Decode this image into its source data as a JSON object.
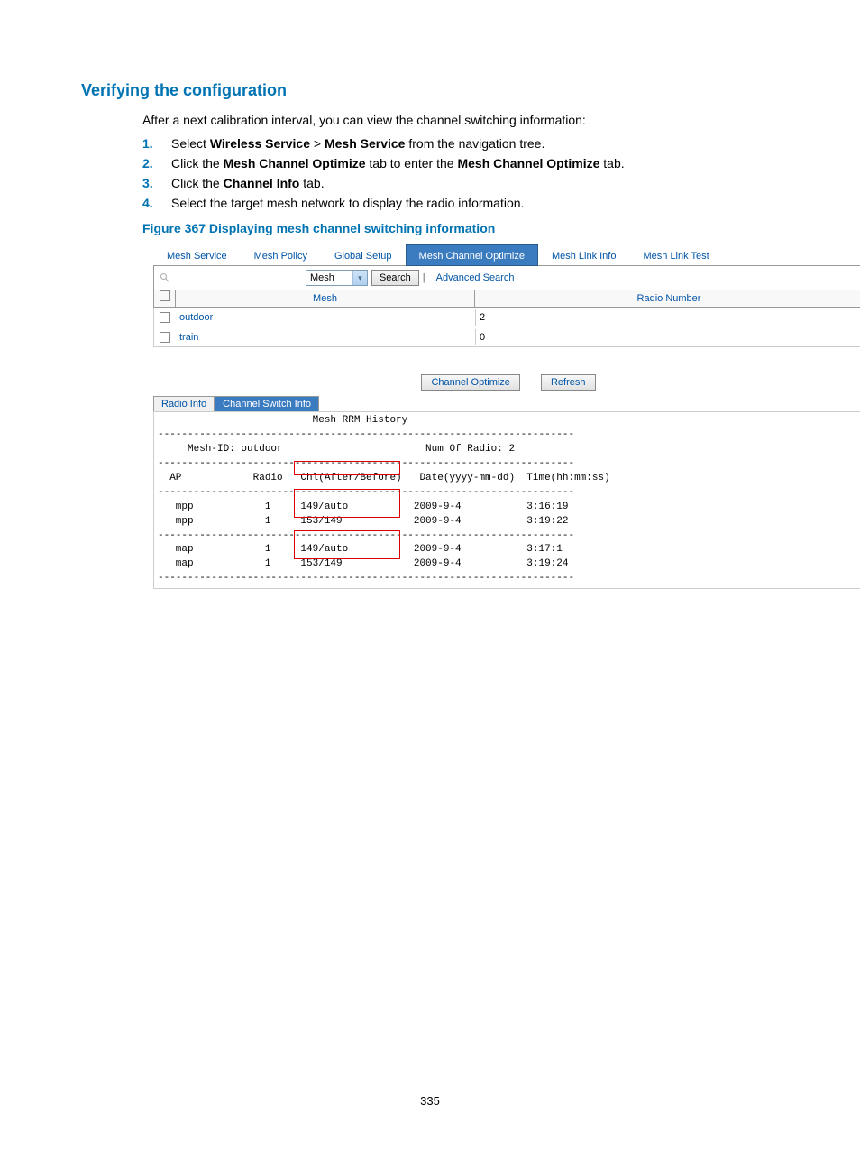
{
  "title": "Verifying the configuration",
  "intro": "After a next calibration interval, you can view the channel switching information:",
  "steps": [
    {
      "num": "1.",
      "pre": "Select ",
      "b1": "Wireless Service",
      "mid": " > ",
      "b2": "Mesh Service",
      "post": " from the navigation tree."
    },
    {
      "num": "2.",
      "pre": "Click the ",
      "b1": "Mesh Channel Optimize",
      "mid": " tab to enter the ",
      "b2": "Mesh Channel Optimize",
      "post": " tab."
    },
    {
      "num": "3.",
      "pre": "Click the ",
      "b1": "Channel Info",
      "mid": "",
      "b2": "",
      "post": " tab."
    },
    {
      "num": "4.",
      "pre": "Select the target mesh network to display the radio information.",
      "b1": "",
      "mid": "",
      "b2": "",
      "post": ""
    }
  ],
  "figcap": "Figure 367 Displaying mesh channel switching information",
  "tabs": [
    "Mesh Service",
    "Mesh Policy",
    "Global Setup",
    "Mesh Channel Optimize",
    "Mesh Link Info",
    "Mesh Link Test"
  ],
  "select_value": "Mesh",
  "search_btn": "Search",
  "adv_link": "Advanced Search",
  "grid_headers": {
    "mesh": "Mesh",
    "radio": "Radio Number"
  },
  "rows": [
    {
      "name": "outdoor",
      "radio": "2"
    },
    {
      "name": "train",
      "radio": "0"
    }
  ],
  "action_buttons": [
    "Channel Optimize",
    "Refresh"
  ],
  "sub_tabs": [
    "Radio Info",
    "Channel Switch Info"
  ],
  "history": "                          Mesh RRM History\n----------------------------------------------------------------------\n     Mesh-ID: outdoor                        Num Of Radio: 2\n----------------------------------------------------------------------\n  AP            Radio   Chl(After/Before)   Date(yyyy-mm-dd)  Time(hh:mm:ss)\n----------------------------------------------------------------------\n   mpp            1     149/auto           2009-9-4           3:16:19\n   mpp            1     153/149            2009-9-4           3:19:22\n----------------------------------------------------------------------\n   map            1     149/auto           2009-9-4           3:17:1\n   map            1     153/149            2009-9-4           3:19:24\n----------------------------------------------------------------------",
  "pagenum": "335"
}
